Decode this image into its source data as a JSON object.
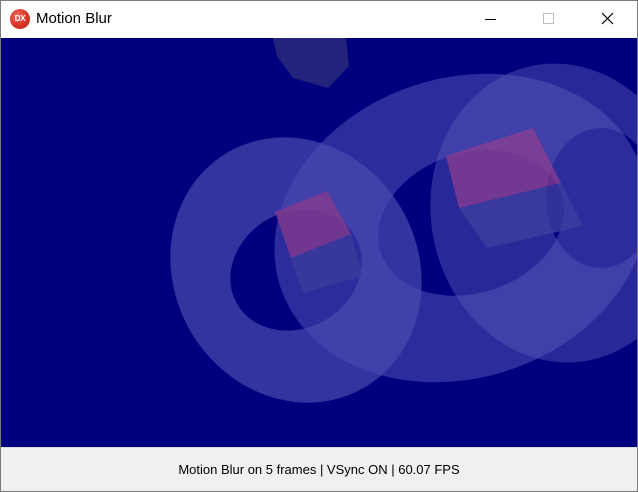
{
  "window": {
    "title": "Motion Blur",
    "icon_label": "DX",
    "buttons": {
      "minimize": "minimize-icon",
      "maximize": "maximize-icon",
      "close": "close-icon"
    }
  },
  "scene": {
    "background_color": "#00007f",
    "objects": [
      "torus",
      "torus",
      "cube",
      "cube",
      "cube"
    ]
  },
  "status": {
    "text": "Motion Blur on 5 frames | VSync ON | 60.07 FPS"
  }
}
